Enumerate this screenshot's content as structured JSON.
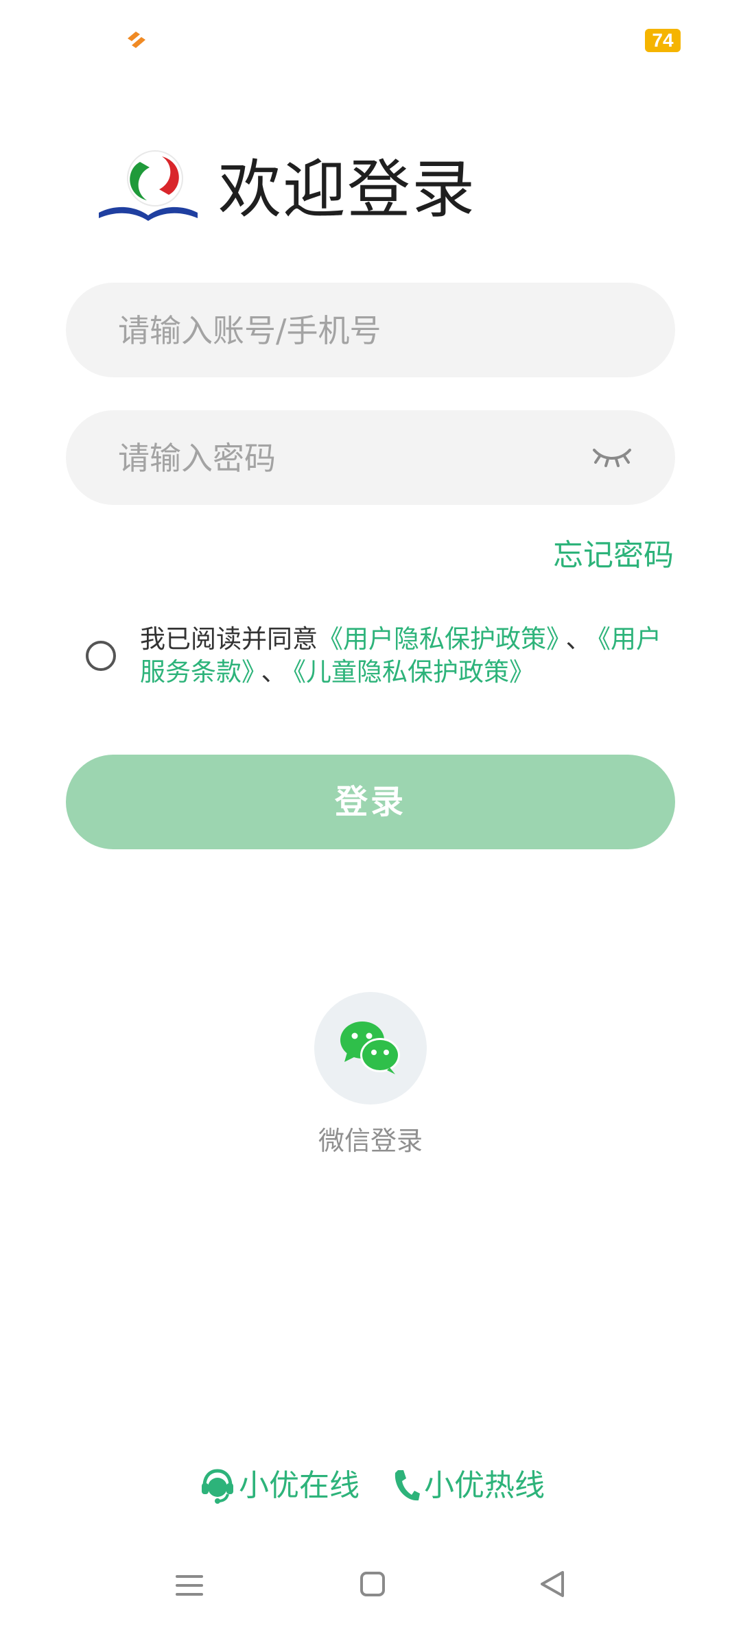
{
  "status_bar": {
    "battery_level": "74",
    "app_icon": "app-notification-icon",
    "battery_color": "#f5b400"
  },
  "header": {
    "logo_icon": "app-logo-icon",
    "title": "欢迎登录"
  },
  "form": {
    "account_placeholder": "请输入账号/手机号",
    "account_value": "",
    "password_placeholder": "请输入密码",
    "password_value": "",
    "password_visibility_icon": "eye-closed-icon",
    "forgot_password": "忘记密码"
  },
  "agreement": {
    "checked": false,
    "prefix": "我已阅读并同意",
    "privacy_policy": "《用户隐私保护政策》",
    "separator": "、",
    "service_terms": "《用户服务条款》",
    "children_policy": "《儿童隐私保护政策》"
  },
  "login_button": {
    "label": "登录",
    "color": "#9cd5b0"
  },
  "third_party": {
    "wechat_icon": "wechat-icon",
    "wechat_label": "微信登录"
  },
  "support": {
    "online_icon": "customer-service-icon",
    "online_label": "小优在线",
    "hotline_icon": "phone-icon",
    "hotline_label": "小优热线",
    "accent_color": "#2db37a"
  },
  "nav_bar": {
    "menu_icon": "menu-icon",
    "home_icon": "home-square-icon",
    "back_icon": "back-triangle-icon"
  }
}
